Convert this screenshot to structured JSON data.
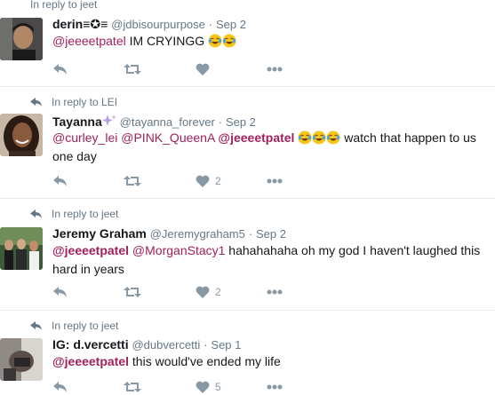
{
  "tweets": [
    {
      "reply_to": "In reply to jeet",
      "name": "derin≡✪≡",
      "handle": "@jdbisourpurpose",
      "date": "Sep 2",
      "mentions": [
        "@jeeeetpatel"
      ],
      "text": "IM CRYINGG",
      "emoji_count": 2,
      "likes": ""
    },
    {
      "reply_to": "In reply to LEI",
      "name": "Tayanna",
      "handle": "@tayanna_forever",
      "date": "Sep 2",
      "mentions": [
        "@curley_lei",
        "@PINK_QueenA",
        "@jeeeetpatel"
      ],
      "text": "watch that happen to us one day",
      "emoji_count": 3,
      "likes": "2"
    },
    {
      "reply_to": "In reply to jeet",
      "name": "Jeremy Graham",
      "handle": "@Jeremygraham5",
      "date": "Sep 2",
      "mentions": [
        "@jeeeetpatel",
        "@MorganStacy1"
      ],
      "text": "hahahahaha oh my god I haven't laughed this hard in years",
      "emoji_count": 0,
      "likes": "2"
    },
    {
      "reply_to": "In reply to jeet",
      "name": "IG: d.vercetti",
      "handle": "@dubvercetti",
      "date": "Sep 1",
      "mentions": [
        "@jeeeetpatel"
      ],
      "text": "this would've ended my life",
      "emoji_count": 0,
      "likes": "5"
    }
  ],
  "icons": {
    "reply": "reply-icon",
    "retweet": "retweet-icon",
    "like": "heart-icon",
    "more": "more-icon",
    "emoji": "face-with-tears-of-joy-icon"
  },
  "colors": {
    "mention": "#a0215b",
    "muted": "#657786",
    "action": "#8899a6",
    "separator": "#e6ecf0"
  }
}
